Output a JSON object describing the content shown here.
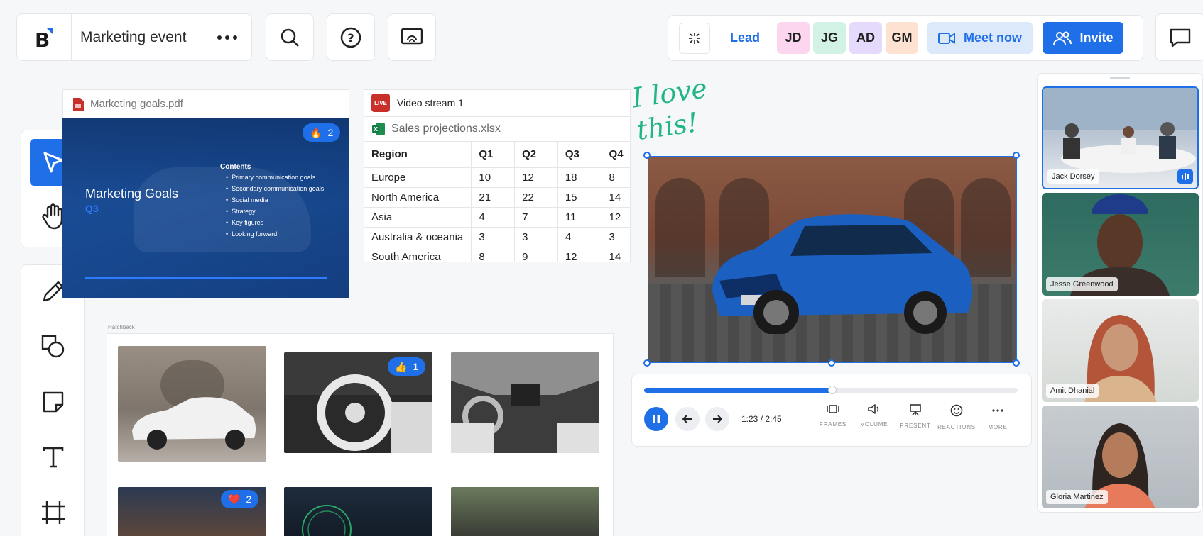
{
  "header": {
    "board_title": "Marketing event",
    "lead_label": "Lead",
    "avatars": [
      {
        "initials": "JD",
        "color": "#fcd5ee"
      },
      {
        "initials": "JG",
        "color": "#d3f2e6"
      },
      {
        "initials": "AD",
        "color": "#e5dafc"
      },
      {
        "initials": "GM",
        "color": "#fde2d2"
      }
    ],
    "meet_now_label": "Meet now",
    "invite_label": "Invite"
  },
  "toolbar": {
    "tools": [
      "select-tool",
      "hand-tool",
      "pen-tool",
      "shapes-tool",
      "sticky-note-tool",
      "text-tool",
      "frame-tool"
    ]
  },
  "pdf": {
    "file_name": "Marketing goals.pdf",
    "slide_title": "Marketing Goals",
    "slide_subtitle": "Q3",
    "contents_heading": "Contents",
    "contents_items": [
      "Primary communication goals",
      "Secondary communication goals",
      "Social media",
      "Strategy",
      "Key figures",
      "Looking forward"
    ],
    "reaction_count": "2"
  },
  "video_stream": {
    "live_badge": "LIVE",
    "title": "Video stream 1"
  },
  "spreadsheet": {
    "file_name": "Sales projections.xlsx",
    "columns": [
      "Region",
      "Q1",
      "Q2",
      "Q3",
      "Q4"
    ],
    "rows": [
      [
        "Europe",
        "10",
        "12",
        "18",
        "8"
      ],
      [
        "North America",
        "21",
        "22",
        "15",
        "14"
      ],
      [
        "Asia",
        "4",
        "7",
        "11",
        "12"
      ],
      [
        "Australia & oceania",
        "3",
        "3",
        "4",
        "3"
      ],
      [
        "South America",
        "8",
        "9",
        "12",
        "14"
      ]
    ]
  },
  "annotation": {
    "line1": "I love",
    "line2": "this!"
  },
  "player": {
    "time": "1:23 / 2:45",
    "progress": 0.503,
    "controls": [
      "FRAMES",
      "VOLUME",
      "PRESENT",
      "REACTIONS",
      "MORE"
    ]
  },
  "gallery": {
    "label": "Hatchback",
    "like_count": "1",
    "heart_count": "2"
  },
  "participants": [
    {
      "name": "Jack Dorsey",
      "speaking": true
    },
    {
      "name": "Jesse Greenwood",
      "speaking": false
    },
    {
      "name": "Amit Dhanial",
      "speaking": false
    },
    {
      "name": "Gloria Martinez",
      "speaking": false
    }
  ],
  "colors": {
    "accent": "#1f6fe8",
    "annotation": "#1fb584",
    "live": "#c9302c"
  }
}
